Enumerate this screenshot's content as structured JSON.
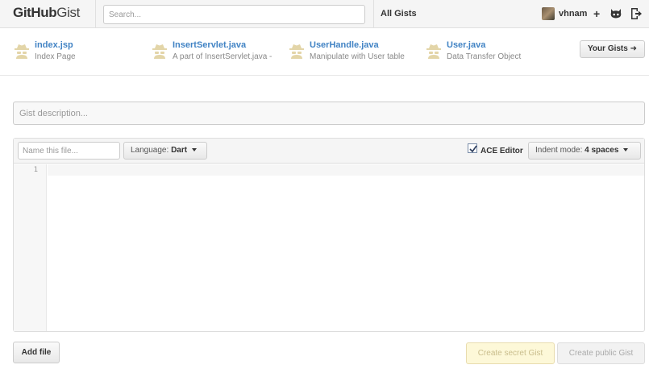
{
  "header": {
    "logo_bold": "GitHub",
    "logo_light": "Gist",
    "search_placeholder": "Search...",
    "all_gists": "All Gists",
    "username": "vhnam",
    "plus": "+"
  },
  "recent_gists": [
    {
      "title": "index.jsp",
      "description": "Index Page"
    },
    {
      "title": "InsertServlet.java",
      "description": "A part of InsertServlet.java -"
    },
    {
      "title": "UserHandle.java",
      "description": "Manipulate with User table"
    },
    {
      "title": "User.java",
      "description": "Data Transfer Object"
    }
  ],
  "your_gists_label": "Your Gists",
  "gist_description_placeholder": "Gist description...",
  "file": {
    "name_placeholder": "Name this file...",
    "language_label": "Language:",
    "language_value": "Dart",
    "ace_editor_label": "ACE Editor",
    "ace_editor_checked": true,
    "indent_label": "Indent mode:",
    "indent_value": "4 spaces",
    "line_number": "1"
  },
  "buttons": {
    "add_file": "Add file",
    "create_secret": "Create secret Gist",
    "create_public": "Create public Gist"
  },
  "colors": {
    "link": "#4183c4",
    "secret_bg": "#fdf8d8"
  }
}
